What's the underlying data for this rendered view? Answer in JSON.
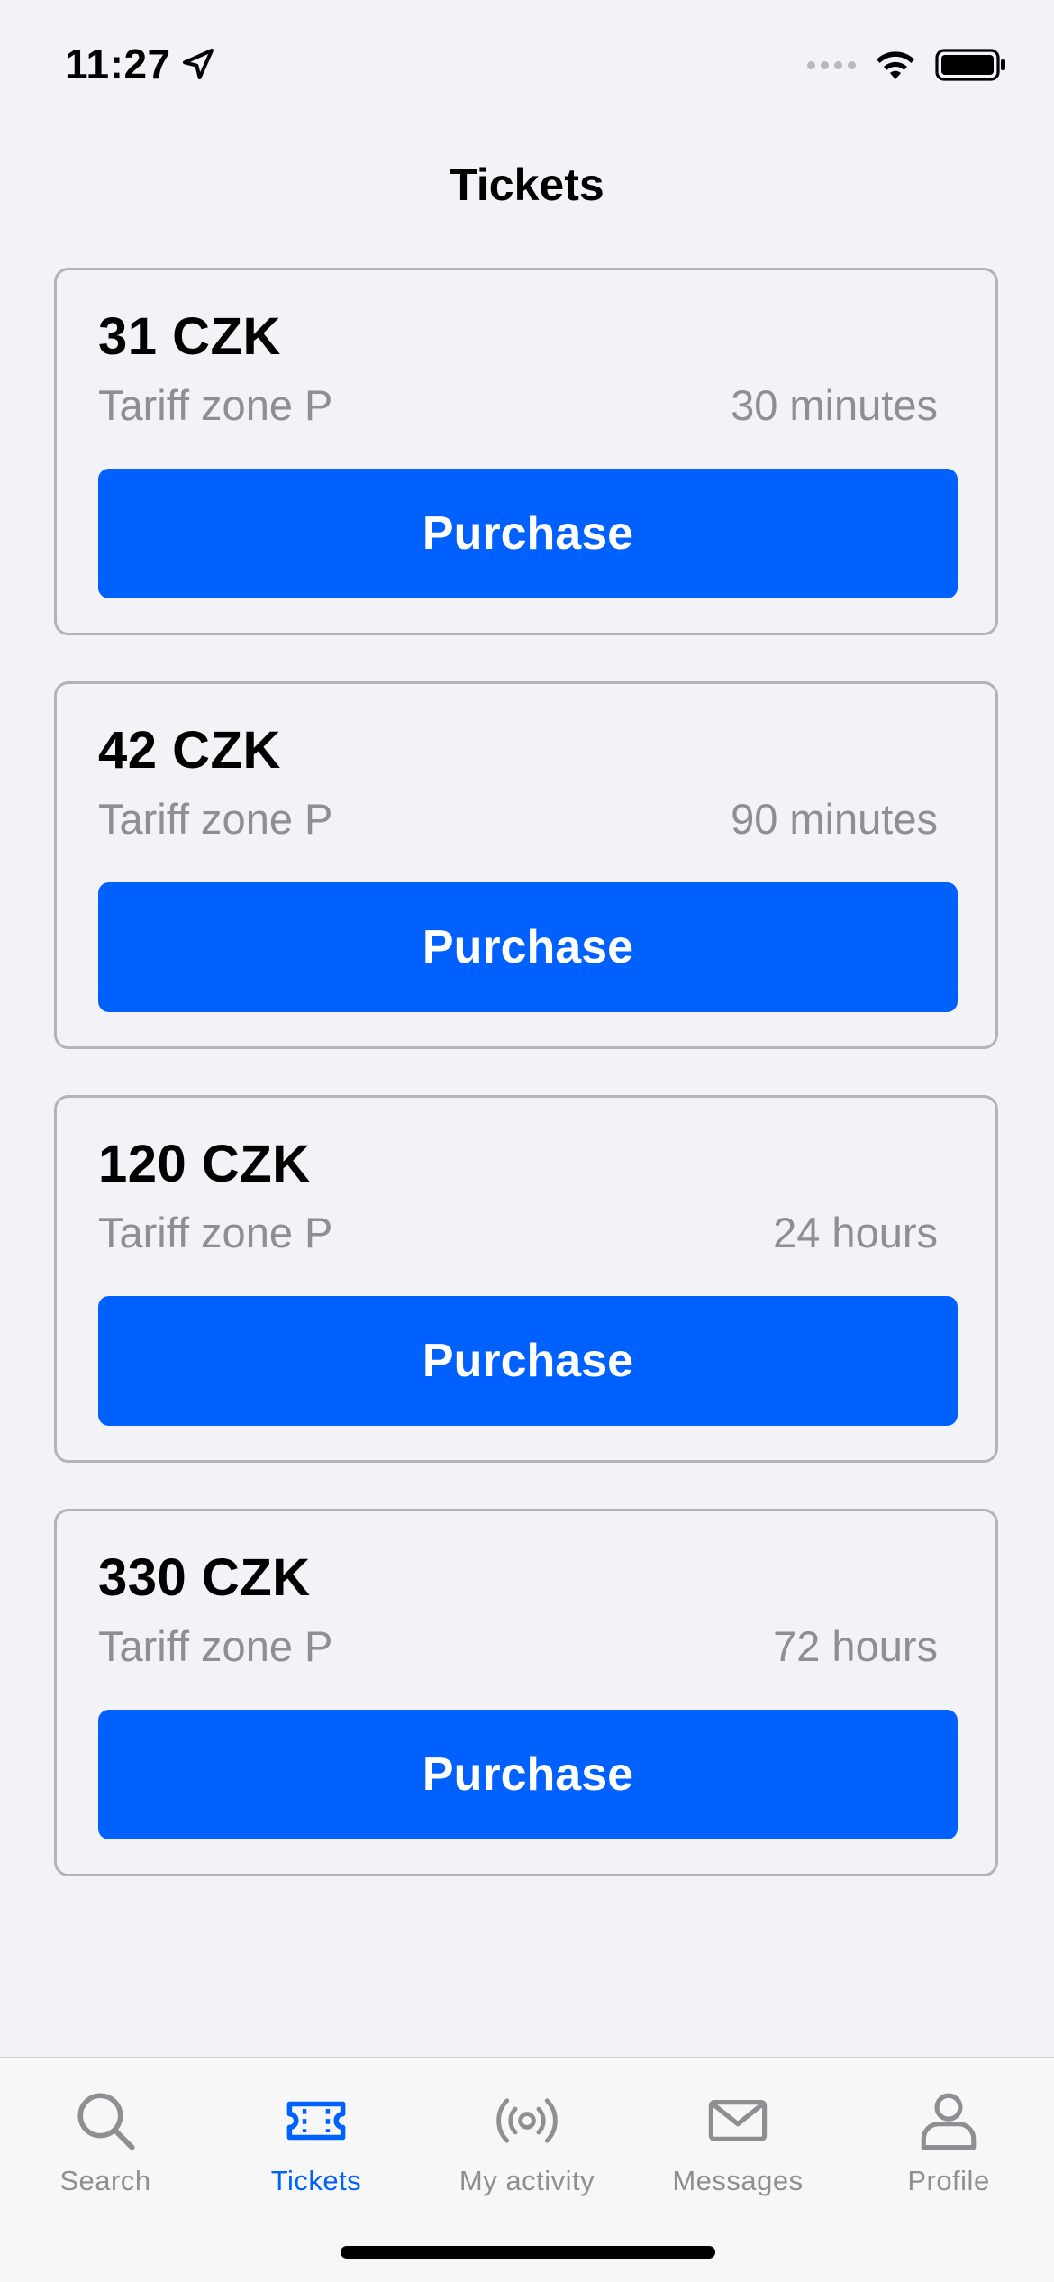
{
  "status_bar": {
    "time": "11:27",
    "icons": [
      "location-arrow-icon",
      "signal-icon",
      "wifi-icon",
      "battery-icon"
    ]
  },
  "header": {
    "title": "Tickets"
  },
  "tickets": [
    {
      "price": "31 CZK",
      "zone": "Tariff zone P",
      "duration": "30 minutes",
      "button_label": "Purchase"
    },
    {
      "price": "42 CZK",
      "zone": "Tariff zone P",
      "duration": "90 minutes",
      "button_label": "Purchase"
    },
    {
      "price": "120 CZK",
      "zone": "Tariff zone P",
      "duration": "24 hours",
      "button_label": "Purchase"
    },
    {
      "price": "330 CZK",
      "zone": "Tariff zone P",
      "duration": "72 hours",
      "button_label": "Purchase"
    }
  ],
  "tab_bar": {
    "tabs": [
      {
        "label": "Search",
        "icon": "search-icon",
        "active": false
      },
      {
        "label": "Tickets",
        "icon": "ticket-icon",
        "active": true
      },
      {
        "label": "My activity",
        "icon": "broadcast-icon",
        "active": false
      },
      {
        "label": "Messages",
        "icon": "envelope-icon",
        "active": false
      },
      {
        "label": "Profile",
        "icon": "person-icon",
        "active": false
      }
    ]
  },
  "colors": {
    "accent": "#0061ff",
    "background": "#f2f2f7",
    "secondary_text": "#8e8e93",
    "card_border": "#b4b4b8"
  }
}
